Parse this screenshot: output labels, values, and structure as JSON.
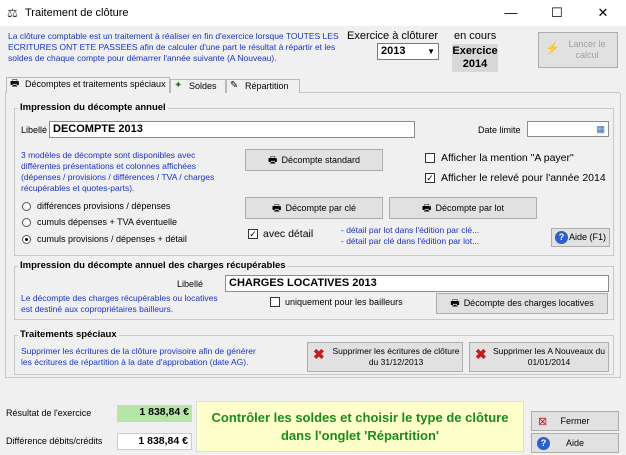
{
  "window": {
    "title": "Traitement de clôture",
    "minimize": "—",
    "maximize": "☐",
    "close": "✕"
  },
  "intro_text": "La clôture comptable est un traitement à réaliser en fin d'exercice lorsque TOUTES LES ECRITURES ONT ETE PASSEES afin de calculer d'une part le résultat à répartir et les soldes de chaque compte pour démarrer l'année suivante (A Nouveau).",
  "header": {
    "exercice_label": "Exercice à clôturer",
    "exercice_value": "2013",
    "en_cours_label": "en cours",
    "en_cours_value": "Exercice 2014",
    "lancer_calcul": "Lancer le calcul"
  },
  "tabs": [
    {
      "label": "Décomptes et traitements spéciaux"
    },
    {
      "label": "Soldes"
    },
    {
      "label": "Répartition"
    }
  ],
  "decompte_annuel": {
    "title": "Impression du décompte annuel",
    "libelle_label": "Libellé",
    "libelle_value": "DECOMPTE 2013",
    "date_limite_label": "Date limite",
    "description": "3 modèles de décompte sont disponibles avec différentes présentations et colonnes affichées (dépenses / provisions / différences / TVA / charges récupérables et quotes-parts).",
    "radios": [
      {
        "label": "différences provisions / dépenses",
        "selected": false
      },
      {
        "label": "cumuls dépenses + TVA éventuelle",
        "selected": false
      },
      {
        "label": "cumuls provisions / dépenses + détail",
        "selected": true
      }
    ],
    "btn_standard": "Décompte standard",
    "btn_par_cle": "Décompte par clé",
    "btn_par_lot": "Décompte par lot",
    "chk_a_payer": "Afficher la mention \"A payer\"",
    "chk_a_payer_checked": false,
    "chk_releve": "Afficher le relevé pour l'année 2014",
    "chk_releve_checked": true,
    "chk_detail": "avec détail",
    "chk_detail_checked": true,
    "detail_lot": "- détail par lot dans l'édition par clé...",
    "detail_cle": "- détail par clé dans l'édition par lot...",
    "aide": "Aide (F1)"
  },
  "charges_recup": {
    "title": "Impression du décompte annuel des charges récupérables",
    "libelle_label": "Libellé",
    "libelle_value": "CHARGES LOCATIVES 2013",
    "description": "Le décompte des charges récupérables ou locatives est destiné aux copropriétaires bailleurs.",
    "chk_bailleurs": "uniquement pour les bailleurs",
    "btn": "Décompte des charges locatives"
  },
  "traitements": {
    "title": "Traitements spéciaux",
    "description": "Supprimer les écritures de la clôture provisoire afin de générer les écritures de répartition à la date d'approbation (date AG).",
    "btn_supprimer_cloture": "Supprimer les écritures de clôture du 31/12/2013",
    "btn_supprimer_an": "Supprimer les A Nouveaux du 01/01/2014"
  },
  "footer": {
    "resultat_label": "Résultat de l'exercice",
    "resultat_value": "1 838,84 €",
    "difference_label": "Différence débits/crédits",
    "difference_value": "1 838,84 €",
    "message": "Contrôler les soldes et choisir le type de clôture dans l'onglet 'Répartition'",
    "fermer": "Fermer",
    "aide": "Aide"
  }
}
